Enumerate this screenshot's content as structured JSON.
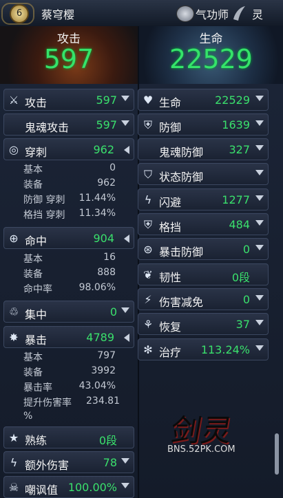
{
  "header": {
    "level": "6",
    "name": "蔡穹樱",
    "class": "气功师",
    "race": "灵"
  },
  "summary": {
    "attack_label": "攻击",
    "attack_value": "597",
    "hp_label": "生命",
    "hp_value": "22529"
  },
  "left": {
    "attack": {
      "label": "攻击",
      "value": "597"
    },
    "soul_attack": {
      "label": "鬼魂攻击",
      "value": "597"
    },
    "pierce": {
      "label": "穿刺",
      "value": "962",
      "details": [
        {
          "k": "基本",
          "v": "0"
        },
        {
          "k": "装备",
          "v": "962"
        },
        {
          "k": "防御 穿刺",
          "v": "11.44%"
        },
        {
          "k": "格挡 穿刺",
          "v": "11.34%"
        }
      ]
    },
    "accuracy": {
      "label": "命中",
      "value": "904",
      "details": [
        {
          "k": "基本",
          "v": "16"
        },
        {
          "k": "装备",
          "v": "888"
        },
        {
          "k": "命中率",
          "v": "98.06%"
        }
      ]
    },
    "concentration": {
      "label": "集中",
      "value": "0"
    },
    "critical": {
      "label": "暴击",
      "value": "4789",
      "details": [
        {
          "k": "基本",
          "v": "797"
        },
        {
          "k": "装备",
          "v": "3992"
        },
        {
          "k": "暴击率",
          "v": "43.04%"
        },
        {
          "k": "提升伤害率",
          "v": "234.81"
        },
        {
          "k": "%",
          "v": ""
        }
      ]
    },
    "mastery": {
      "label": "熟练",
      "value": "0段"
    },
    "extra_damage": {
      "label": "额外伤害",
      "value": "78"
    },
    "taunt": {
      "label": "嘲讽值",
      "value": "100.00%"
    }
  },
  "right": {
    "hp": {
      "label": "生命",
      "value": "22529"
    },
    "defense": {
      "label": "防御",
      "value": "1639"
    },
    "soul_defense": {
      "label": "鬼魂防御",
      "value": "327"
    },
    "status_defense": {
      "label": "状态防御",
      "value": ""
    },
    "evasion": {
      "label": "闪避",
      "value": "1277"
    },
    "block": {
      "label": "格挡",
      "value": "484"
    },
    "crit_defense": {
      "label": "暴击防御",
      "value": "0"
    },
    "toughness": {
      "label": "韧性",
      "value": "0段"
    },
    "damage_reduction": {
      "label": "伤害减免",
      "value": "0"
    },
    "recovery": {
      "label": "恢复",
      "value": "37"
    },
    "healing": {
      "label": "治疗",
      "value": "113.24%"
    }
  },
  "watermark": {
    "logo": "剑灵",
    "url": "BNS.52PK.COM"
  },
  "colors": {
    "value_green": "#3ae06c",
    "panel_bg": "#141b29"
  }
}
